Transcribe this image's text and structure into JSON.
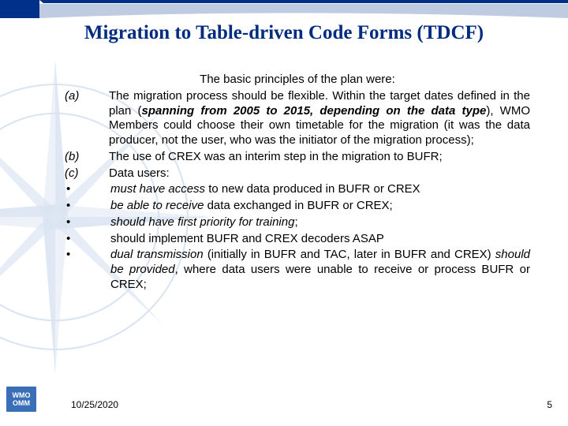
{
  "title": "Migration to Table-driven Code Forms (TDCF)",
  "intro": "The basic principles of the plan were:",
  "items": [
    {
      "marker": "(a)",
      "pre": "The migration process should be flexible.  Within the target dates defined in the plan (",
      "emph": "spanning from 2005 to 2015, depending on the data type",
      "post": "), WMO Members could choose their own timetable for the migration (it was the data producer, not the user, who was the initiator of the migration process);"
    },
    {
      "marker": "(b)",
      "text": "The use of CREX was an interim step in the migration to BUFR;"
    },
    {
      "marker": "(c)",
      "text": "Data users:"
    }
  ],
  "bullets": [
    {
      "emph": "must have access",
      "tail": " to new data produced in BUFR or CREX"
    },
    {
      "emph": "be able to receive",
      "tail": " data exchanged in BUFR or CREX;"
    },
    {
      "emph": "should have first priority for training",
      "tail": ";"
    },
    {
      "plain": "should implement BUFR and CREX decoders ASAP"
    },
    {
      "emph": "dual transmission",
      "mid": " (initially in BUFR and TAC, later in BUFR and CREX) ",
      "emph2": "should be provided",
      "tail": ", where data users were unable to receive or process BUFR or CREX;"
    }
  ],
  "footer": {
    "date": "10/25/2020",
    "page": "5"
  },
  "logo": {
    "l1": "WMO",
    "l2": "OMM"
  }
}
